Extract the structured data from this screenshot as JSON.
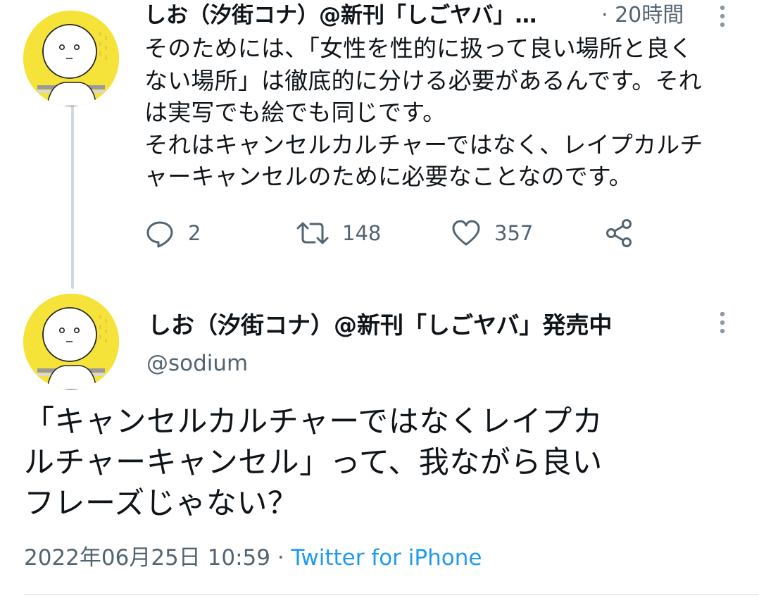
{
  "reply_tweet": {
    "display_name": "しお（汐街コナ）@新刊「しごヤバ」…",
    "time": "· 20時間",
    "lines": [
      "そのためには、「女性を性的に扱って良い場所と良く",
      "ない場所」は徹底的に分ける必要があるんです。それ",
      "は実写でも絵でも同じです。",
      "それはキャンセルカルチャーではなく、レイプカルチ",
      "ャーキャンセルのために必要なことなのです。"
    ],
    "actions": {
      "reply_count": "2",
      "retweet_count": "148",
      "like_count": "357"
    }
  },
  "main_tweet": {
    "display_name": "しお（汐街コナ）@新刊「しごヤバ」発売中",
    "handle": "@sodium",
    "lines": [
      "「キャンセルカルチャーではなくレイプカ",
      "ルチャーキャンセル」って、我ながら良い",
      "フレーズじゃない？"
    ],
    "timestamp": "2022年06月25日 10:59",
    "separator": " · ",
    "source": "Twitter for iPhone"
  },
  "icons": {
    "reply": "reply-icon",
    "retweet": "retweet-icon",
    "like": "heart-icon",
    "share": "share-icon",
    "more": "more-vertical-icon"
  },
  "colors": {
    "text": "#0f1419",
    "secondary": "#536471",
    "link": "#1d9bf0",
    "avatar_bg": "#f5e33a",
    "thread_line": "#cfd9de"
  }
}
